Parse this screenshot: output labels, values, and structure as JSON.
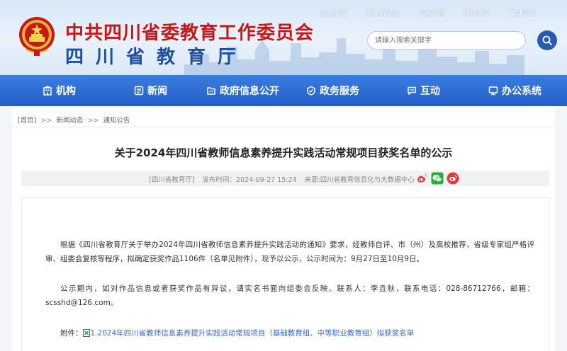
{
  "header": {
    "org_title": "中共四川省委教育工作委员会",
    "dept_title": "四川省教育厅",
    "top_links": [
      "智能问答",
      "无障碍浏览",
      "长者专区",
      "移动门户",
      "繁体中文"
    ]
  },
  "search": {
    "placeholder": "请输入搜索关键字"
  },
  "nav": {
    "items": [
      {
        "label": "机构",
        "icon": "building-icon"
      },
      {
        "label": "新闻",
        "icon": "newspaper-icon"
      },
      {
        "label": "政府信息公开",
        "icon": "info-open-icon"
      },
      {
        "label": "政务服务",
        "icon": "service-icon"
      },
      {
        "label": "互动",
        "icon": "chat-icon"
      },
      {
        "label": "办公系统",
        "icon": "office-icon"
      }
    ]
  },
  "breadcrumb": {
    "items": [
      "[首页]",
      "新闻动态",
      "通知公告"
    ],
    "separator": ">>"
  },
  "article": {
    "title": "关于2024年四川省教师信息素养提升实践活动常规项目获奖名单的公示",
    "meta": {
      "source_org": "[四川省教育厅]",
      "publish_time": "发布时间：2024-09-27 15:24",
      "source": "来源:四川省教育信息化与大数据中心"
    },
    "share_icons": [
      "weibo-share-icon",
      "wechat-share-icon",
      "sina-share-icon"
    ],
    "paragraphs": [
      "根据《四川省教育厅关于举办2024年四川省教师信息素养提升实践活动的通知》要求，经教师自评、市（州）及高校推荐，省级专家组严格评审、组委会复核等程序，拟确定获奖作品1106件（名单见附件），现予以公示，公示时间为：9月27日至10月9日。",
      "公示期内，如对作品信息或者获奖作品有异议，请实名书面向组委会反映。联系人：李垚秋，联系电话：028-86712766，邮箱：scsshd@126.com。"
    ],
    "attachment": {
      "label": "附件：",
      "link_text": "1.2024年四川省教师信息素养提升实践活动常规项目（基础教育组、中等职业教育组）拟获奖名单"
    }
  },
  "colors": {
    "brand_red": "#c81717",
    "brand_blue": "#1d4fa3",
    "nav_blue": "#2360c8",
    "link_blue": "#3a68c4"
  }
}
